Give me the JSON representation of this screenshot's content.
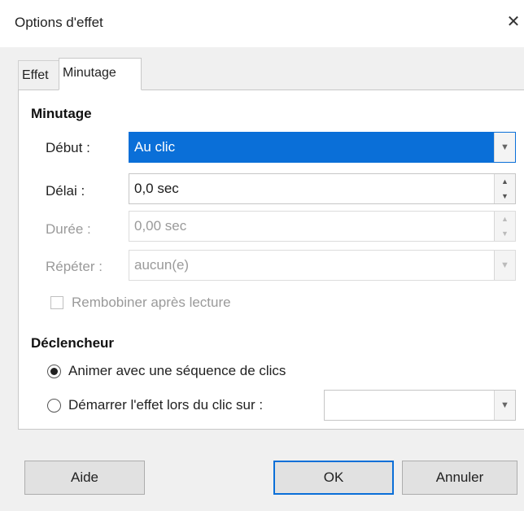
{
  "window": {
    "title": "Options d'effet",
    "close_glyph": "✕"
  },
  "tabs": [
    {
      "label": "Effet"
    },
    {
      "label": "Minutage"
    }
  ],
  "timing": {
    "heading": "Minutage",
    "start": {
      "label": "Début :",
      "value": "Au clic"
    },
    "delay": {
      "label": "Délai :",
      "value": "0,0 sec"
    },
    "duration": {
      "label": "Durée :",
      "value": "0,00 sec"
    },
    "repeat": {
      "label": "Répéter :",
      "value": "aucun(e)"
    },
    "rewind": {
      "label": "Rembobiner après lecture",
      "checked": false
    }
  },
  "trigger": {
    "heading": "Déclencheur",
    "option_sequence": {
      "label": "Animer avec une séquence de clics",
      "checked": true
    },
    "option_click": {
      "label": "Démarrer l'effet lors du clic sur :",
      "checked": false,
      "value": ""
    }
  },
  "buttons": {
    "help": "Aide",
    "ok": "OK",
    "cancel": "Annuler"
  },
  "colors": {
    "selection": "#0a6fd8",
    "dialog_bg": "#f0f0f0"
  }
}
